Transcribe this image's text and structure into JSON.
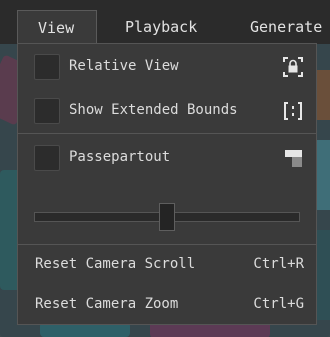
{
  "menubar": {
    "menus": [
      "View",
      "Playback",
      "Generate"
    ]
  },
  "view_menu": {
    "relative_view": {
      "label": "Relative View",
      "checked": false,
      "icon": "lock-frame-icon"
    },
    "extended_bounds": {
      "label": "Show Extended Bounds",
      "checked": false,
      "icon": "bounds-brackets-icon"
    },
    "passepartout": {
      "label": "Passepartout",
      "checked": false,
      "icon": "passepartout-corner-icon"
    },
    "slider": {
      "value": 0.5
    },
    "reset_scroll": {
      "label": "Reset Camera Scroll",
      "shortcut": "Ctrl+R"
    },
    "reset_zoom": {
      "label": "Reset Camera Zoom",
      "shortcut": "Ctrl+G"
    }
  },
  "colors": {
    "menubar_bg": "#2b2b2b",
    "popup_bg": "#3a3a3a",
    "text": "#dcdcdc"
  }
}
